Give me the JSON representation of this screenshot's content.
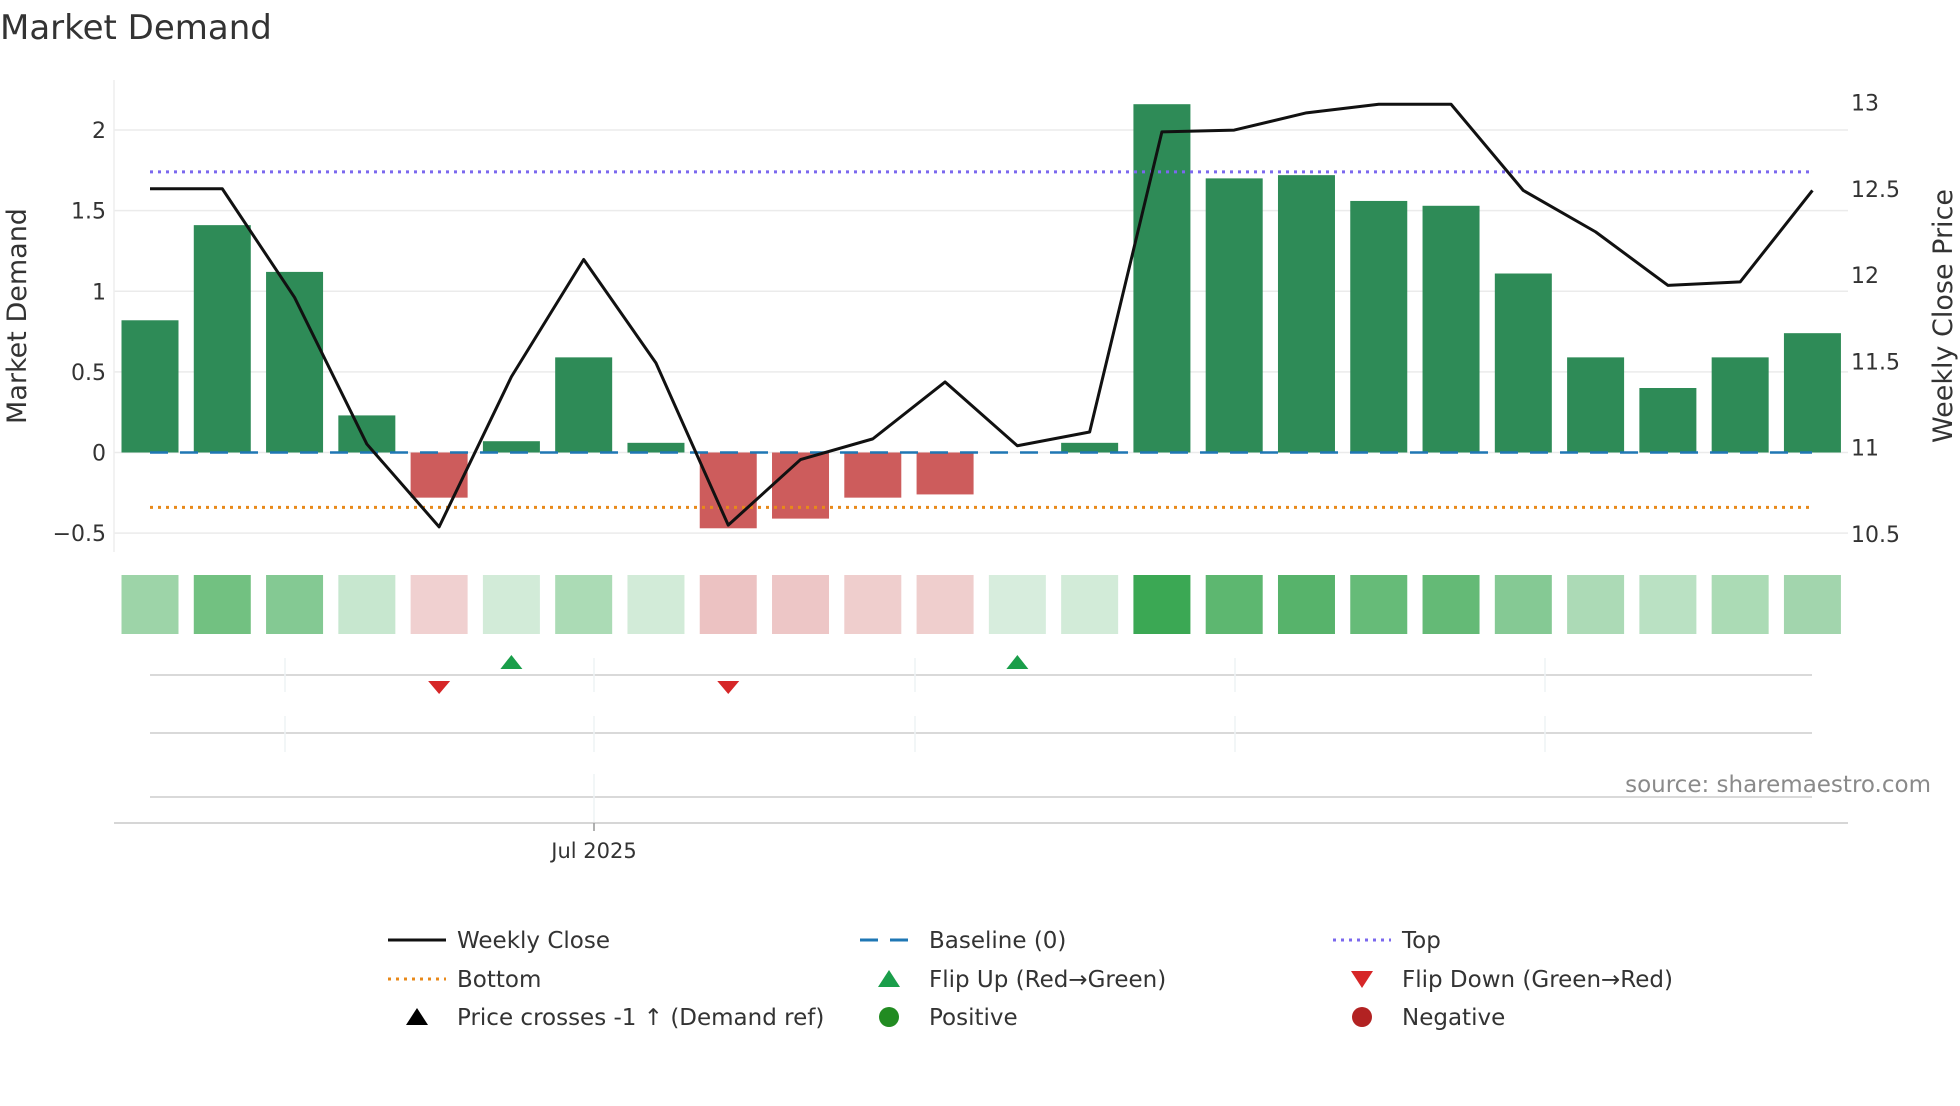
{
  "chart_data": {
    "type": "bar",
    "title": "Market Demand",
    "ylabel": "Market Demand",
    "y2label": "Weekly Close Price",
    "ylim": [
      -0.55,
      2.4
    ],
    "y2lim": [
      10.45,
      13.2
    ],
    "yticks": [
      -0.5,
      0,
      0.5,
      1,
      1.5,
      2
    ],
    "ytick_labels": [
      "−0.5",
      "0",
      "0.5",
      "1",
      "1.5",
      "2"
    ],
    "y2ticks": [
      10.5,
      11,
      11.5,
      12,
      12.5,
      13
    ],
    "y2tick_labels": [
      "10.5",
      "11",
      "11.5",
      "12",
      "12.5",
      "13"
    ],
    "xtick_label": "Jul 2025",
    "xtick_index": 6,
    "grid": true,
    "demand": [
      0.82,
      1.41,
      1.12,
      0.23,
      -0.28,
      0.07,
      0.59,
      0.06,
      -0.47,
      -0.41,
      -0.28,
      -0.26,
      0.0,
      0.06,
      2.16,
      1.7,
      1.72,
      1.56,
      1.53,
      1.11,
      0.59,
      0.4,
      0.59,
      0.74
    ],
    "weekly_close": [
      12.5,
      12.5,
      11.87,
      11.02,
      10.54,
      11.41,
      12.09,
      11.49,
      10.55,
      10.93,
      11.05,
      11.38,
      11.01,
      11.09,
      12.83,
      12.84,
      12.94,
      12.99,
      12.99,
      12.49,
      12.25,
      11.94,
      11.96,
      12.49
    ],
    "top": 1.74,
    "bottom": -0.34,
    "baseline": 0,
    "heat_colors": [
      "#9dd4a8",
      "#72c181",
      "#84c993",
      "#c7e7cf",
      "#f0d0d0",
      "#d2ebd8",
      "#abdbb5",
      "#d2ebd8",
      "#ecc2c2",
      "#edc6c6",
      "#efcecd",
      "#efcecd",
      "#d7eddd",
      "#d2ebd8",
      "#3ba854",
      "#5db770",
      "#57b36b",
      "#66bb78",
      "#64ba76",
      "#85c994",
      "#acdab6",
      "#bae1c3",
      "#abdbb5",
      "#a2d5ad"
    ],
    "flip_up_indices": [
      5,
      12
    ],
    "flip_down_indices": [
      4,
      8
    ],
    "colors": {
      "positive_bar": "#2e8b57",
      "negative_bar": "#cd5c5c",
      "line": "#111111",
      "baseline": "#1f77b4",
      "top": "#7b68ee",
      "bottom": "#e8891a",
      "flip_up": "#1a9e4a",
      "flip_down": "#d62728",
      "positive": "#228b22",
      "negative": "#b22222"
    },
    "source": "source: sharemaestro.com",
    "legend": [
      {
        "label": "Weekly Close",
        "symbol": "line-solid",
        "color": "#111111"
      },
      {
        "label": "Baseline (0)",
        "symbol": "line-dashed",
        "color": "#1f77b4"
      },
      {
        "label": "Top",
        "symbol": "line-dotted",
        "color": "#7b68ee"
      },
      {
        "label": "Bottom",
        "symbol": "line-dotted",
        "color": "#e8891a"
      },
      {
        "label": "Flip Up (Red→Green)",
        "symbol": "triangle-up",
        "color": "#1a9e4a"
      },
      {
        "label": "Flip Down (Green→Red)",
        "symbol": "triangle-down",
        "color": "#d62728"
      },
      {
        "label": "Price crosses -1 ↑ (Demand ref)",
        "symbol": "triangle-up",
        "color": "#000000"
      },
      {
        "label": "Positive",
        "symbol": "circle",
        "color": "#228b22"
      },
      {
        "label": "Negative",
        "symbol": "circle",
        "color": "#b22222"
      }
    ]
  }
}
